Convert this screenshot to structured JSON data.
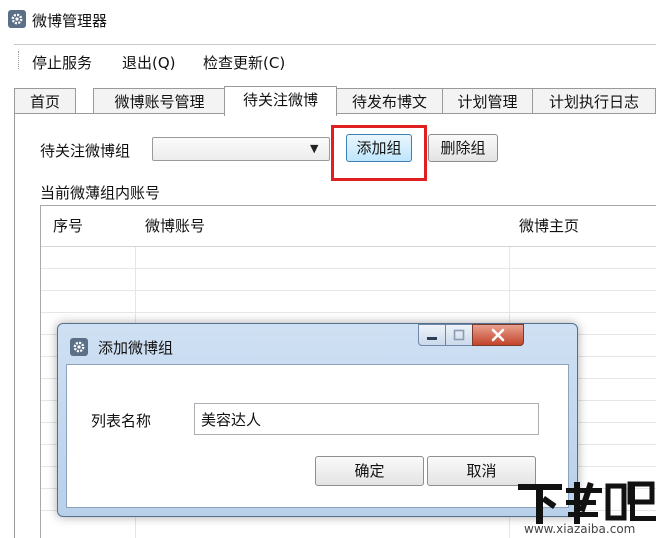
{
  "window": {
    "title": "微博管理器"
  },
  "menu": {
    "items": [
      "停止服务",
      "退出(Q)",
      "检查更新(C)"
    ]
  },
  "tabs": [
    "首页",
    "微博账号管理",
    "待关注微博",
    "待发布博文",
    "计划管理",
    "计划执行日志"
  ],
  "active_tab_index": 2,
  "group_row": {
    "label": "待关注微博组",
    "select_value": "",
    "add_button": "添加组",
    "delete_button": "删除组"
  },
  "list": {
    "label": "当前微薄组内账号",
    "columns": [
      "序号",
      "微博账号",
      "微博主页"
    ]
  },
  "dialog": {
    "title": "添加微博组",
    "field_label": "列表名称",
    "field_value": "美容达人",
    "ok_button": "确定",
    "cancel_button": "取消"
  },
  "watermark": {
    "logo": "下载吧",
    "url": "www.xiazaiba.com"
  },
  "colors": {
    "highlight": "#e02020",
    "close_button": "#c3442b",
    "dialog_frame": "#b8d0ea"
  }
}
